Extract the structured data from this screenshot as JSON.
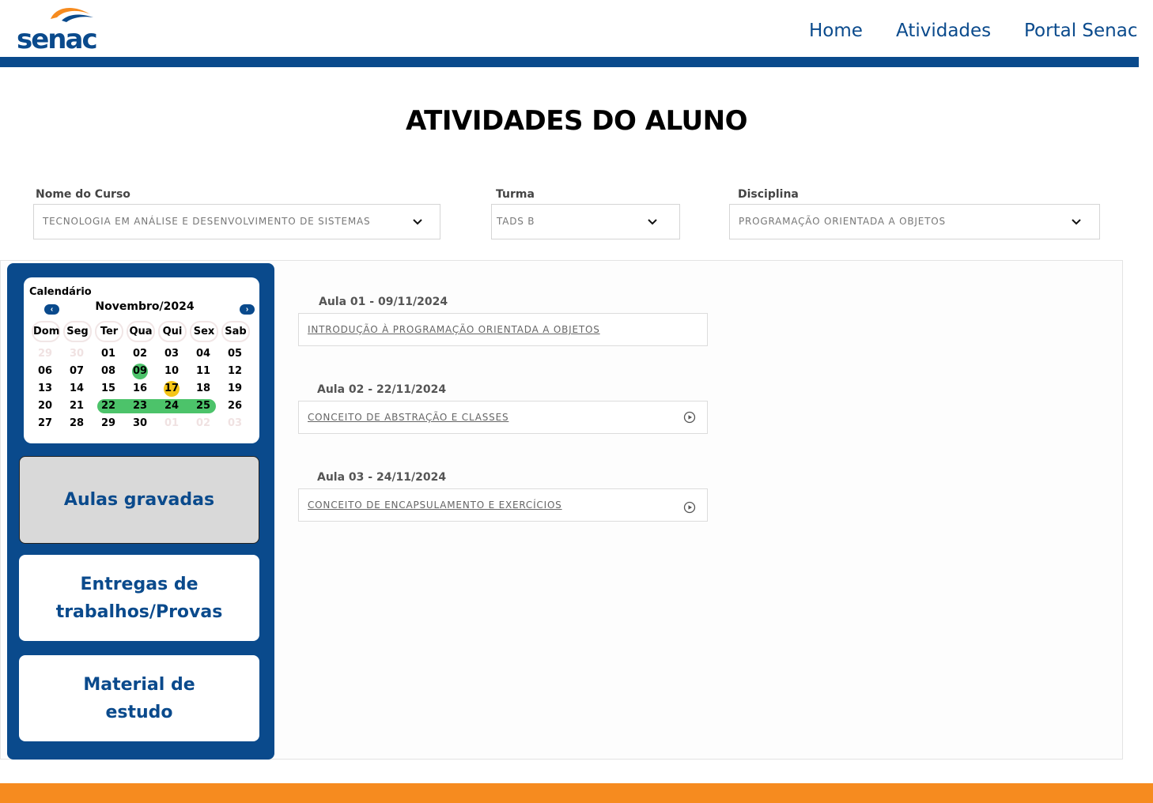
{
  "colors": {
    "brand_blue": "#0a4a8c",
    "brand_orange": "#f68b1f",
    "green": "#4cc36a",
    "yellow": "#f5c518"
  },
  "header": {
    "logo_text": "senac",
    "nav": {
      "home": "Home",
      "atividades": "Atividades",
      "portal": "Portal Senac"
    }
  },
  "page_title": "ATIVIDADES DO ALUNO",
  "filters": {
    "curso": {
      "label": "Nome do Curso",
      "value": "TECNOLOGIA EM ANÁLISE E DESENVOLVIMENTO DE SISTEMAS"
    },
    "turma": {
      "label": "Turma",
      "value": "TADS B"
    },
    "disciplina": {
      "label": "Disciplina",
      "value": "PROGRAMAÇÃO ORIENTADA A OBJETOS"
    }
  },
  "calendar": {
    "title": "Calendário",
    "month": "Novembro/2024",
    "prev_icon": "‹",
    "next_icon": "›",
    "weekdays": [
      "Dom",
      "Seg",
      "Ter",
      "Qua",
      "Qui",
      "Sex",
      "Sab"
    ],
    "weeks": [
      [
        "29",
        "30",
        "01",
        "02",
        "03",
        "04",
        "05"
      ],
      [
        "06",
        "07",
        "08",
        "09",
        "10",
        "11",
        "12"
      ],
      [
        "13",
        "14",
        "15",
        "16",
        "17",
        "18",
        "19"
      ],
      [
        "20",
        "21",
        "22",
        "23",
        "24",
        "25",
        "26"
      ],
      [
        "27",
        "28",
        "29",
        "30",
        "01",
        "02",
        "03"
      ]
    ],
    "highlighted_green": [
      "09",
      "22",
      "23",
      "24",
      "25"
    ],
    "highlighted_yellow": [
      "17"
    ]
  },
  "sidebar": {
    "aulas": "Aulas gravadas",
    "entregas_line1": "Entregas de",
    "entregas_line2": "trabalhos/Provas",
    "material_line1": "Material de",
    "material_line2": "estudo"
  },
  "lessons": [
    {
      "heading": "Aula 01 - 09/11/2024",
      "title": "INTRODUÇÃO À PROGRAMAÇÃO ORIENTADA A OBJETOS",
      "has_play": false
    },
    {
      "heading": "Aula 02 - 22/11/2024",
      "title": "CONCEITO DE ABSTRAÇÃO E CLASSES",
      "has_play": true
    },
    {
      "heading": "Aula 03 - 24/11/2024",
      "title": "CONCEITO DE ENCAPSULAMENTO E EXERCÍCIOS",
      "has_play": true
    }
  ]
}
